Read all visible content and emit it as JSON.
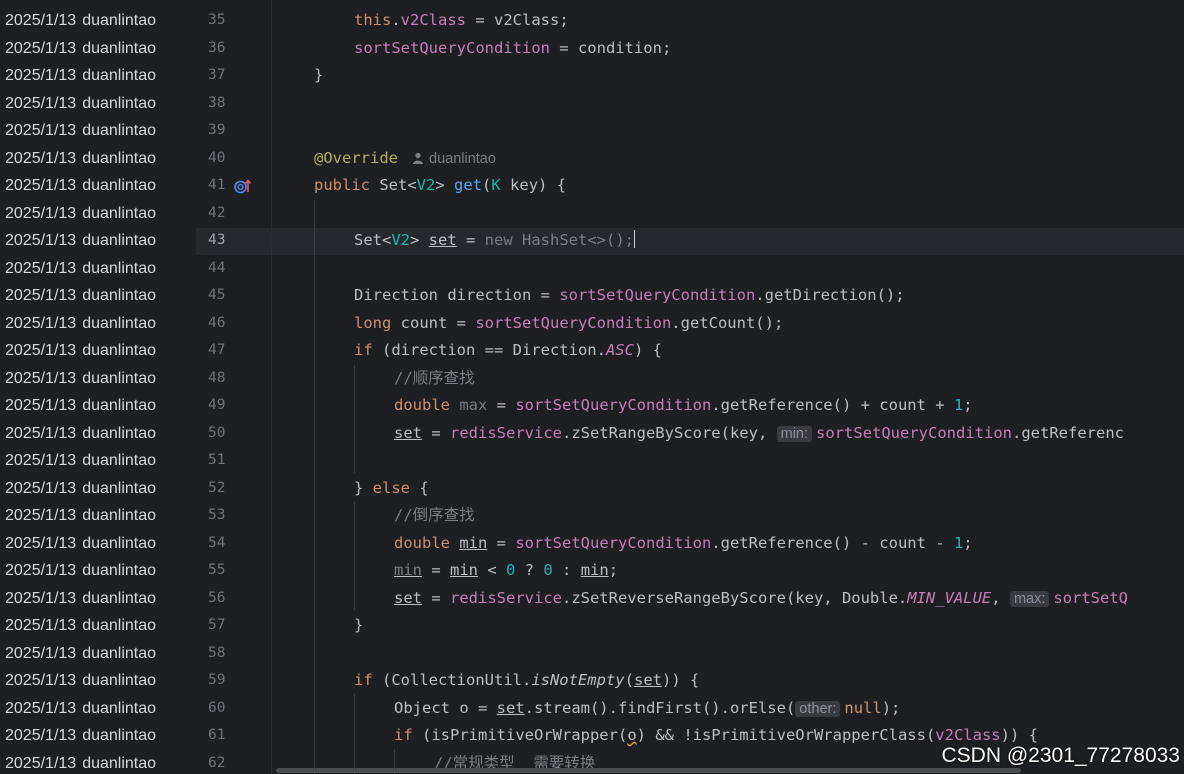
{
  "blame": [
    {
      "date": "2025/1/13",
      "author": "duanlintao"
    },
    {
      "date": "2025/1/13",
      "author": "duanlintao"
    },
    {
      "date": "2025/1/13",
      "author": "duanlintao"
    },
    {
      "date": "2025/1/13",
      "author": "duanlintao"
    },
    {
      "date": "2025/1/13",
      "author": "duanlintao"
    },
    {
      "date": "2025/1/13",
      "author": "duanlintao"
    },
    {
      "date": "2025/1/13",
      "author": "duanlintao"
    },
    {
      "date": "2025/1/13",
      "author": "duanlintao"
    },
    {
      "date": "2025/1/13",
      "author": "duanlintao"
    },
    {
      "date": "2025/1/13",
      "author": "duanlintao"
    },
    {
      "date": "2025/1/13",
      "author": "duanlintao"
    },
    {
      "date": "2025/1/13",
      "author": "duanlintao"
    },
    {
      "date": "2025/1/13",
      "author": "duanlintao"
    },
    {
      "date": "2025/1/13",
      "author": "duanlintao"
    },
    {
      "date": "2025/1/13",
      "author": "duanlintao"
    },
    {
      "date": "2025/1/13",
      "author": "duanlintao"
    },
    {
      "date": "2025/1/13",
      "author": "duanlintao"
    },
    {
      "date": "2025/1/13",
      "author": "duanlintao"
    },
    {
      "date": "2025/1/13",
      "author": "duanlintao"
    },
    {
      "date": "2025/1/13",
      "author": "duanlintao"
    },
    {
      "date": "2025/1/13",
      "author": "duanlintao"
    },
    {
      "date": "2025/1/13",
      "author": "duanlintao"
    },
    {
      "date": "2025/1/13",
      "author": "duanlintao"
    },
    {
      "date": "2025/1/13",
      "author": "duanlintao"
    },
    {
      "date": "2025/1/13",
      "author": "duanlintao"
    },
    {
      "date": "2025/1/13",
      "author": "duanlintao"
    },
    {
      "date": "2025/1/13",
      "author": "duanlintao"
    },
    {
      "date": "2025/1/13",
      "author": "duanlintao"
    }
  ],
  "line_numbers": [
    "35",
    "36",
    "37",
    "38",
    "39",
    "40",
    "41",
    "42",
    "43",
    "44",
    "45",
    "46",
    "47",
    "48",
    "49",
    "50",
    "51",
    "52",
    "53",
    "54",
    "55",
    "56",
    "57",
    "58",
    "59",
    "60",
    "61",
    "62"
  ],
  "current_line": "43",
  "code": {
    "l35": {
      "this": "this",
      "dot": ".",
      "field": "v2Class",
      "rest": " = v2Class;"
    },
    "l36": {
      "field": "sortSetQueryCondition",
      "rest": " = condition;"
    },
    "l37": {
      "brace": "}"
    },
    "l40": {
      "annotation": "@Override",
      "author_hint": "duanlintao"
    },
    "l41": {
      "kw": "public",
      "t1": " Set<",
      "type": "V2",
      "t2": "> ",
      "method": "get",
      "t3": "(",
      "generic": "K",
      "t4": " key) {"
    },
    "l43": {
      "t1": "Set<",
      "type": "V2",
      "t2": "> ",
      "var": "set",
      "t3": " = ",
      "rest": "new HashSet<>();"
    },
    "l45": {
      "t1": "Direction direction = ",
      "field": "sortSetQueryCondition",
      "t2": ".getDirection();"
    },
    "l46": {
      "kw": "long",
      "t1": " count = ",
      "field": "sortSetQueryCondition",
      "t2": ".getCount();"
    },
    "l47": {
      "kw": "if",
      "t1": " (direction == Direction.",
      "static": "ASC",
      "t2": ") {"
    },
    "l48": {
      "comment": "//顺序查找"
    },
    "l49": {
      "kw": "double",
      "t1": " ",
      "var": "max",
      "t2": " = ",
      "field": "sortSetQueryCondition",
      "t3": ".getReference() + count + ",
      "num": "1",
      "t4": ";"
    },
    "l50": {
      "var": "set",
      "t1": " = ",
      "field": "redisService",
      "t2": ".zSetRangeByScore(key, ",
      "hint": "min:",
      "field2": "sortSetQueryCondition",
      "t3": ".getReferenc"
    },
    "l52": {
      "t1": "} ",
      "kw": "else",
      "t2": " {"
    },
    "l53": {
      "comment": "//倒序查找"
    },
    "l54": {
      "kw": "double",
      "t1": " ",
      "var": "min",
      "t2": " = ",
      "field": "sortSetQueryCondition",
      "t3": ".getReference() - count - ",
      "num": "1",
      "t4": ";"
    },
    "l55": {
      "var": "min",
      "t1": " = ",
      "var2": "min",
      "t2": " < ",
      "n1": "0",
      "t3": " ? ",
      "n2": "0",
      "t4": " : ",
      "var3": "min",
      "t5": ";"
    },
    "l56": {
      "var": "set",
      "t1": " = ",
      "field": "redisService",
      "t2": ".zSetReverseRangeByScore(key, Double.",
      "static": "MIN_VALUE",
      "t3": ", ",
      "hint": "max:",
      "field2": "sortSetQ"
    },
    "l57": {
      "brace": "}"
    },
    "l59": {
      "kw": "if",
      "t1": " (CollectionUtil.",
      "method": "isNotEmpty",
      "t2": "(",
      "var": "set",
      "t3": ")) {"
    },
    "l60": {
      "t1": "Object o = ",
      "var": "set",
      "t2": ".stream().findFirst().orElse(",
      "hint": "other:",
      "kw": "null",
      "t3": ");"
    },
    "l61": {
      "kw": "if",
      "t1": " (isPrimitiveOrWrapper(",
      "var": "o",
      "t2": ") && !isPrimitiveOrWrapperClass(",
      "field": "v2Class",
      "t3": ")) {"
    },
    "l62": {
      "comment": "//常规类型  需要转换"
    }
  },
  "watermark": "CSDN @2301_77278033",
  "icons": {
    "override": "override-implements-icon",
    "author": "person-icon"
  },
  "colors": {
    "background": "#1e1f22",
    "keyword": "#cf8e6d",
    "field": "#c77dbb",
    "method": "#56a8f5",
    "number": "#2aacb8",
    "annotation": "#b3ae60",
    "comment": "#7a7e85"
  }
}
